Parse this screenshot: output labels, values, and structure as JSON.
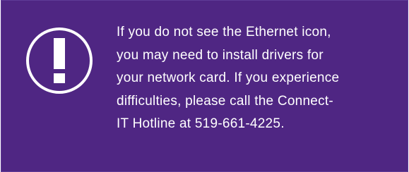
{
  "notice": {
    "background_color": "#4f2683",
    "text_color": "#ffffff",
    "icon": "exclamation-circle-icon",
    "lines": [
      "If you do not see the Ethernet icon,",
      "you may need to install drivers for",
      "your network card. If you experience",
      "difficulties, please call the Connect-",
      "IT Hotline at 519-661-4225."
    ]
  }
}
